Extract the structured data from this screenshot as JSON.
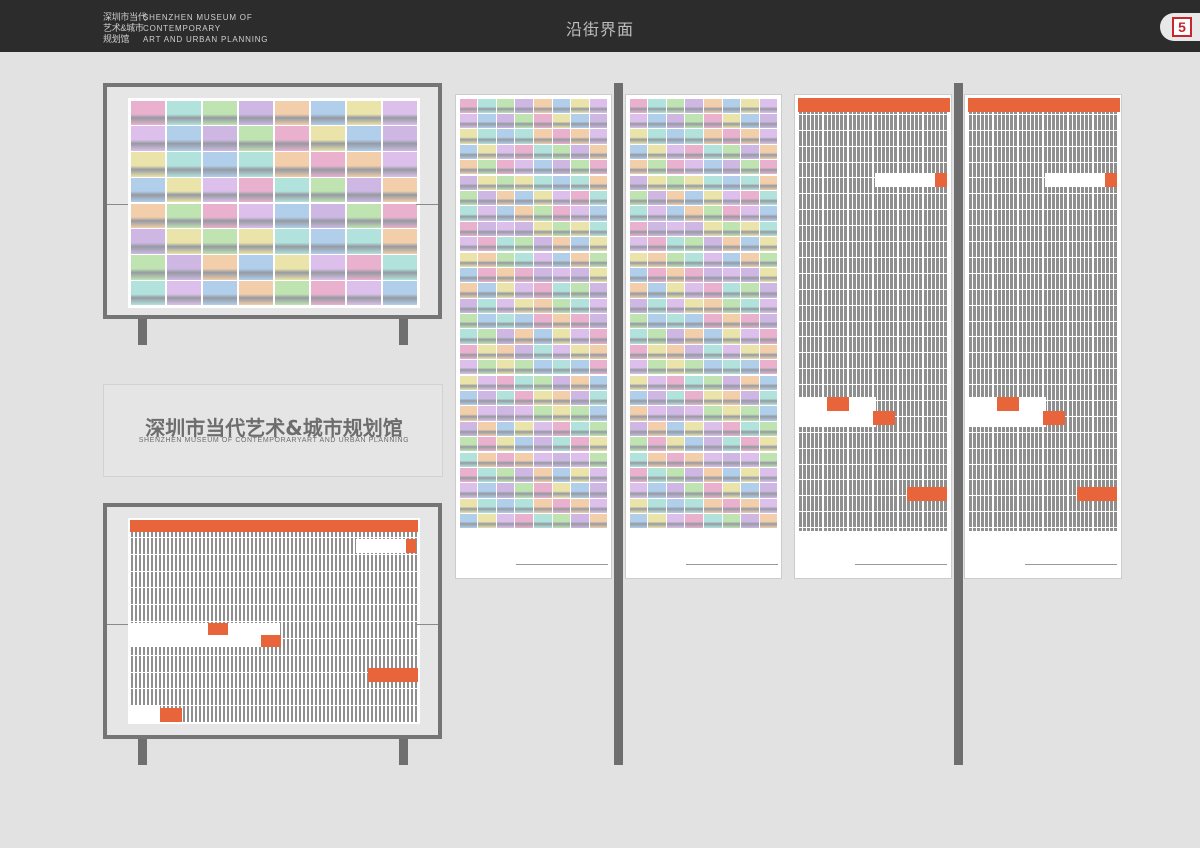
{
  "header": {
    "brand_cn": [
      "深圳市当代",
      "艺术&城市",
      "规划馆"
    ],
    "brand_en": [
      "SHENZHEN MUSEUM OF",
      "CONTEMPORARY",
      "ART AND URBAN PLANNING"
    ],
    "title": "沿街界面",
    "logo_icon": "museum-logo-icon"
  },
  "caption": {
    "cn": "深圳市当代艺术&城市规划馆",
    "en": "SHENZHEN MUSEUM OF CONTEMPORARYART AND URBAN PLANNING"
  },
  "colors": {
    "accent": "#e8643a",
    "grid": "#8f8f8f",
    "header_bg": "#2d2c2c",
    "pole": "#6e6e6e",
    "tiles": [
      "#e8a8c8",
      "#a8c8e8",
      "#b8e0a8",
      "#d8b8e8",
      "#f0c8a0",
      "#a8e0d8",
      "#e8e0a0",
      "#c8b0e0"
    ]
  },
  "panels": [
    {
      "id": "billboard-tiles",
      "type": "tiles"
    },
    {
      "id": "billboard-stripes",
      "type": "stripes"
    },
    {
      "id": "banner-tiles-1",
      "type": "tiles"
    },
    {
      "id": "banner-tiles-2",
      "type": "tiles"
    },
    {
      "id": "banner-stripes-1",
      "type": "stripes"
    },
    {
      "id": "banner-stripes-2",
      "type": "stripes"
    }
  ]
}
